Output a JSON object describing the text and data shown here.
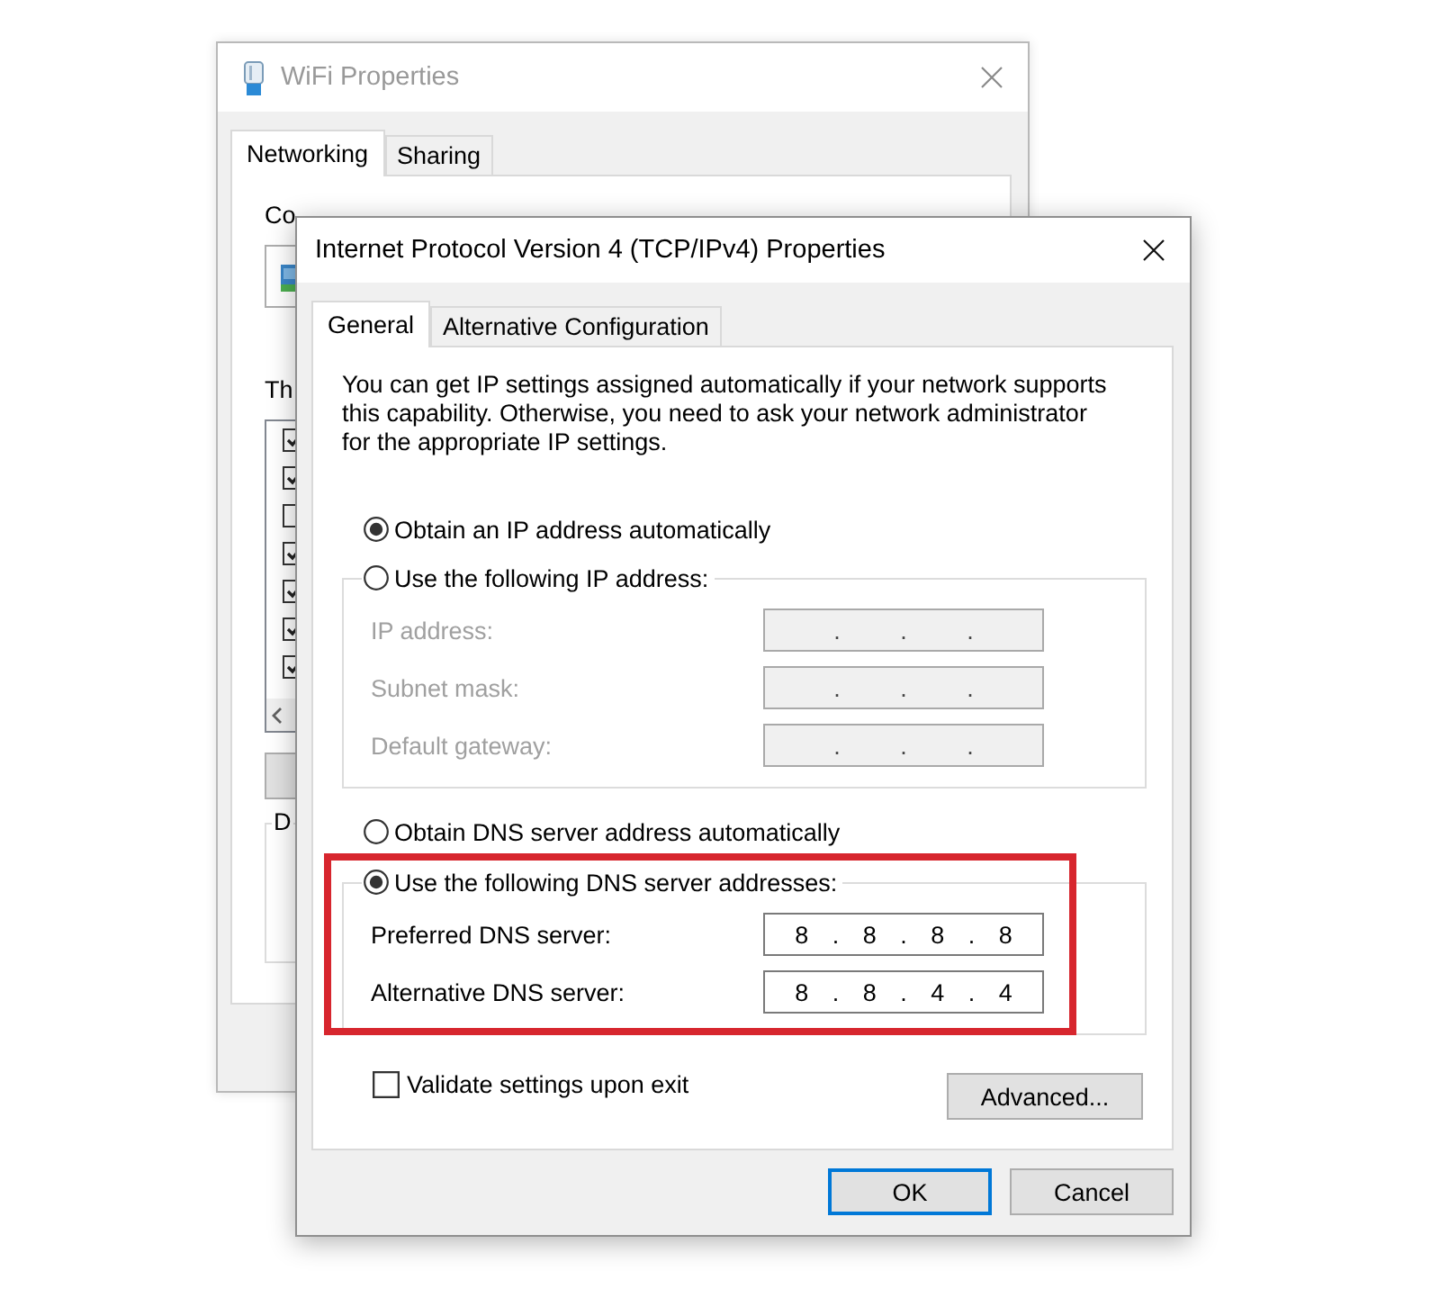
{
  "back_window": {
    "title": "WiFi Properties",
    "tabs": [
      {
        "label": "Networking",
        "selected": true
      },
      {
        "label": "Sharing",
        "selected": false
      }
    ],
    "connect_label": "Co",
    "items_label": "Th",
    "items": [
      {
        "checked": true
      },
      {
        "checked": true
      },
      {
        "checked": false
      },
      {
        "checked": true
      },
      {
        "checked": true
      },
      {
        "checked": true
      },
      {
        "checked": true
      }
    ],
    "group_legend": "D"
  },
  "dialog": {
    "title": "Internet Protocol Version 4 (TCP/IPv4) Properties",
    "tabs": [
      {
        "label": "General",
        "selected": true
      },
      {
        "label": "Alternative Configuration",
        "selected": false
      }
    ],
    "intro": "You can get IP settings assigned automatically if your network supports this capability. Otherwise, you need to ask your network administrator for the appropriate IP settings.",
    "ip": {
      "options": [
        {
          "label": "Obtain an IP address automatically",
          "selected": true
        },
        {
          "label": "Use the following IP address:",
          "selected": false
        }
      ],
      "fields": [
        {
          "label": "IP address:",
          "value": ". . .",
          "disabled": true
        },
        {
          "label": "Subnet mask:",
          "value": ". . .",
          "disabled": true
        },
        {
          "label": "Default gateway:",
          "value": ". . .",
          "disabled": true
        }
      ]
    },
    "dns": {
      "highlighted": true,
      "options": [
        {
          "label": "Obtain DNS server address automatically",
          "selected": false
        },
        {
          "label": "Use the following DNS server addresses:",
          "selected": true
        }
      ],
      "fields": [
        {
          "label": "Preferred DNS server:",
          "value": "8 . 8 . 8 . 8",
          "disabled": false
        },
        {
          "label": "Alternative DNS server:",
          "value": "8 . 8 . 4 . 4",
          "disabled": false
        }
      ]
    },
    "validate": {
      "label": "Validate settings upon exit",
      "checked": false
    },
    "advanced_button": "Advanced...",
    "buttons": [
      {
        "label": "OK",
        "default": true
      },
      {
        "label": "Cancel",
        "default": false
      }
    ]
  }
}
